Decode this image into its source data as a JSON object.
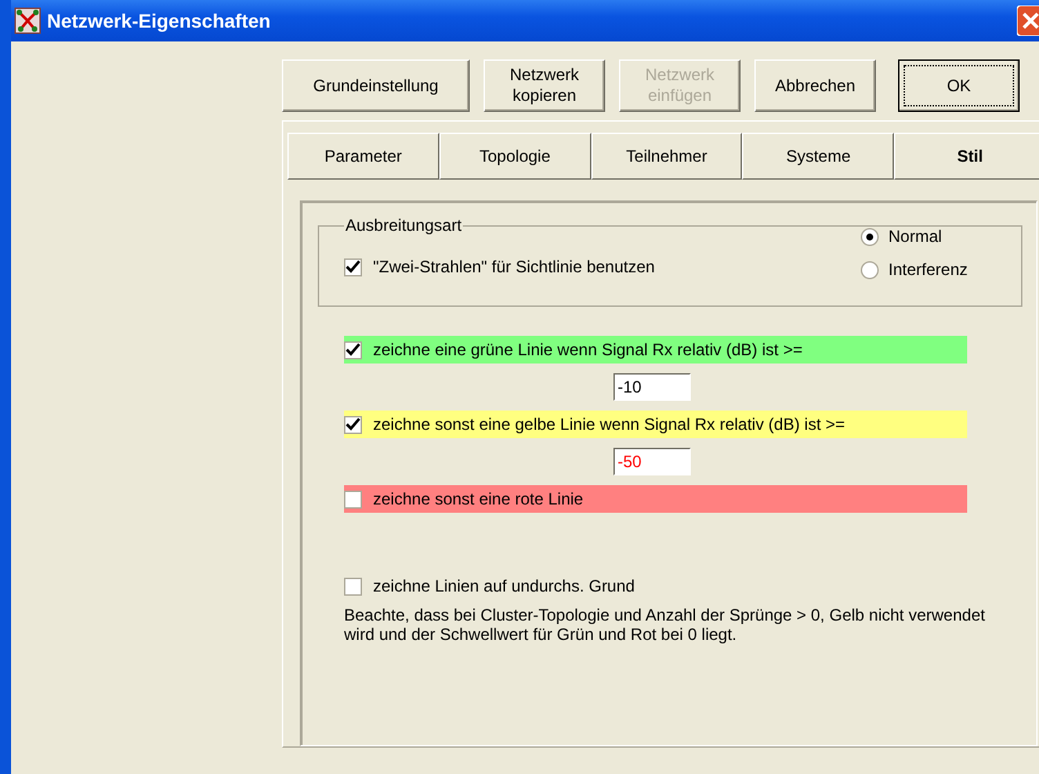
{
  "window": {
    "title": "Netzwerk-Eigenschaften"
  },
  "buttons": [
    {
      "label": "Grundeinstellung",
      "disabled": false,
      "default": false
    },
    {
      "label": "Netzwerk\nkopieren",
      "disabled": false,
      "default": false
    },
    {
      "label": "Netzwerk\neinfügen",
      "disabled": true,
      "default": false
    },
    {
      "label": "Abbrechen",
      "disabled": false,
      "default": false
    },
    {
      "label": "OK",
      "disabled": false,
      "default": true
    }
  ],
  "tabs": [
    {
      "label": "Parameter",
      "selected": false
    },
    {
      "label": "Topologie",
      "selected": false
    },
    {
      "label": "Teilnehmer",
      "selected": false
    },
    {
      "label": "Systeme",
      "selected": false
    },
    {
      "label": "Stil",
      "selected": true
    }
  ],
  "group": {
    "title": "Ausbreitungsart",
    "checkbox": {
      "label": "\"Zwei-Strahlen\" für Sichtlinie benutzen",
      "checked": true
    },
    "radios": [
      {
        "label": "Normal",
        "selected": true
      },
      {
        "label": "Interferenz",
        "selected": false
      }
    ]
  },
  "lines": [
    {
      "label": "zeichne eine grüne Linie wenn Signal Rx relativ (dB) ist >=",
      "checked": true,
      "color": "#80ff80",
      "threshold": {
        "value": "-10",
        "warning": false
      }
    },
    {
      "label": "zeichne sonst eine gelbe Linie wenn Signal Rx relativ (dB) ist >=",
      "checked": true,
      "color": "#ffff80",
      "threshold": {
        "value": "-50",
        "warning": true
      }
    },
    {
      "label": "zeichne sonst eine rote Linie",
      "checked": false,
      "color": "#ff8080"
    }
  ],
  "opaque": {
    "label": "zeichne Linien auf undurchs. Grund",
    "checked": false
  },
  "note": "Beachte, dass bei Cluster-Topologie und Anzahl der Sprünge > 0, Gelb  nicht verwendet wird und der Schwellwert für Grün und Rot bei 0 liegt."
}
